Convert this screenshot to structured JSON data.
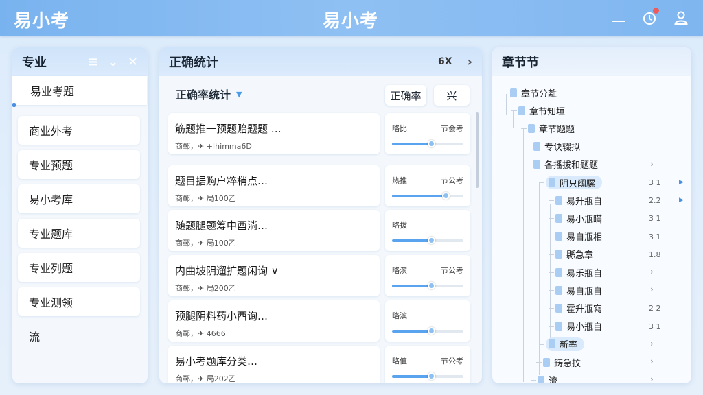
{
  "app": {
    "logo_left": "易小考",
    "logo_center": "易小考"
  },
  "topbar": {
    "icons": [
      "minus-icon",
      "notification-icon",
      "user-icon"
    ]
  },
  "left_panel": {
    "title": "专业",
    "icons": [
      "menu-icon",
      "chevron-down-icon",
      "close-icon"
    ],
    "items": [
      {
        "label": "易业考题",
        "active": true
      },
      {
        "label": "商业外考"
      },
      {
        "label": "专业预题"
      },
      {
        "label": "易小考库"
      },
      {
        "label": "专业题库"
      },
      {
        "label": "专业列题"
      },
      {
        "label": "专业测领"
      },
      {
        "label": "流"
      }
    ]
  },
  "mid_panel": {
    "title": "正确统计",
    "header_right_text": "6X",
    "sub_title": "正确率统计",
    "pill_1": "正确率",
    "pill_2": "兴",
    "questions": [
      {
        "title": "筋题推一预题贻题题 …",
        "meta": "商鄣，✈ +Ihimma6D",
        "side_left": "略比",
        "side_right": "节会考",
        "progress": 0.55
      },
      {
        "title": "题目据购户粹梢点…",
        "meta": "商鄣，✈ 局100乙",
        "side_left": "热推",
        "side_right": "节公考",
        "progress": 0.75
      },
      {
        "title": "随题腿题筹中酉淌…",
        "meta": "商鄣，✈ 局100乙",
        "side_left": "略拔",
        "side_right": "",
        "progress": 0.55
      },
      {
        "title": "内曲坡阴遛扩题闲询 ∨",
        "meta": "商鄣，✈ 局200乙",
        "side_left": "略滨",
        "side_right": "节公考",
        "progress": 0.55
      },
      {
        "title": "预腿阴料药小酉询…",
        "meta": "商鄣，✈ 4666",
        "side_left": "略滨",
        "side_right": "",
        "progress": 0.55
      },
      {
        "title": "易小考题库分类…",
        "meta": "商鄣，✈ 局202乙",
        "side_left": "略值",
        "side_right": "节公考",
        "progress": 0.55
      }
    ]
  },
  "right_panel": {
    "title": "章节节",
    "tree": [
      {
        "label": "章节分離",
        "level": 0
      },
      {
        "label": "章节知垣",
        "level": 1
      },
      {
        "label": "章节题题",
        "level": 2
      },
      {
        "label": "专诀辍拟",
        "level": 3
      },
      {
        "label": "各播拔和题题",
        "level": 3
      },
      {
        "label": "阴只阈騾",
        "level": 4,
        "highlight": true,
        "num": "3 1"
      },
      {
        "label": "易升瓶自",
        "level": 5,
        "num": "2.2"
      },
      {
        "label": "易小瓶瞞",
        "level": 5,
        "num": "3 1"
      },
      {
        "label": "易自瓶相",
        "level": 5,
        "num": "3 1"
      },
      {
        "label": "縣急章",
        "level": 5,
        "num": "1.8"
      },
      {
        "label": "易乐瓶自",
        "level": 5,
        "num": ""
      },
      {
        "label": "易自瓶自",
        "level": 5,
        "num": ""
      },
      {
        "label": "霍升瓶寫",
        "level": 5,
        "num": "2 2"
      },
      {
        "label": "易小瓶自",
        "level": 5,
        "num": "3 1"
      },
      {
        "label": "新率",
        "level": 4,
        "highlight": true,
        "num": ""
      },
      {
        "label": "鋳急抆",
        "level": 3,
        "num": ""
      },
      {
        "label": "流",
        "level": 3,
        "num": ""
      }
    ]
  }
}
